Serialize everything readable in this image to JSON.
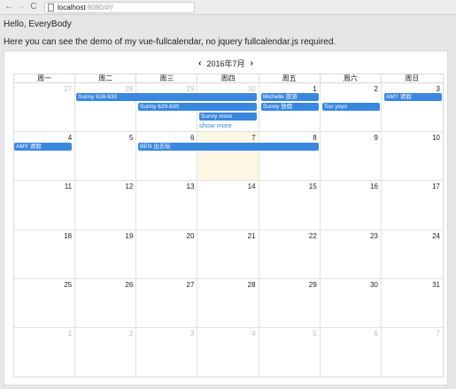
{
  "browser": {
    "back_icon": "←",
    "forward_icon": "→",
    "reload_icon": "C",
    "url_host": "localhost",
    "url_path": ":8080/#!/"
  },
  "page": {
    "greeting": "Hello, EveryBody",
    "description": "Here you can see the demo of my vue-fullcalendar, no jquery fullcalendar.js required."
  },
  "calendar": {
    "title": "2016年7月",
    "prev_icon": "‹",
    "next_icon": "›",
    "weekdays": [
      "周一",
      "周二",
      "周三",
      "周四",
      "周五",
      "周六",
      "周日"
    ],
    "days": [
      "27",
      "28",
      "29",
      "30",
      "1",
      "2",
      "3",
      "4",
      "5",
      "6",
      "7",
      "8",
      "9",
      "10",
      "11",
      "12",
      "13",
      "14",
      "15",
      "16",
      "17",
      "18",
      "19",
      "20",
      "21",
      "22",
      "23",
      "24",
      "25",
      "26",
      "27",
      "28",
      "29",
      "30",
      "31",
      "1",
      "2",
      "3",
      "4",
      "5",
      "6",
      "7"
    ],
    "events": {
      "e1": "Sunny 628-630",
      "e2": "Sunny 629-630",
      "e3": "Sunny more",
      "e4": "Michelle 旅游",
      "e5": "Sunny 放假",
      "e6": "Too yoyo",
      "e7": "AMY 请假",
      "e8": "AMY 请假",
      "e9": "BEN 出去玩"
    },
    "show_more": "show more",
    "accent_color": "#3a87e0"
  }
}
